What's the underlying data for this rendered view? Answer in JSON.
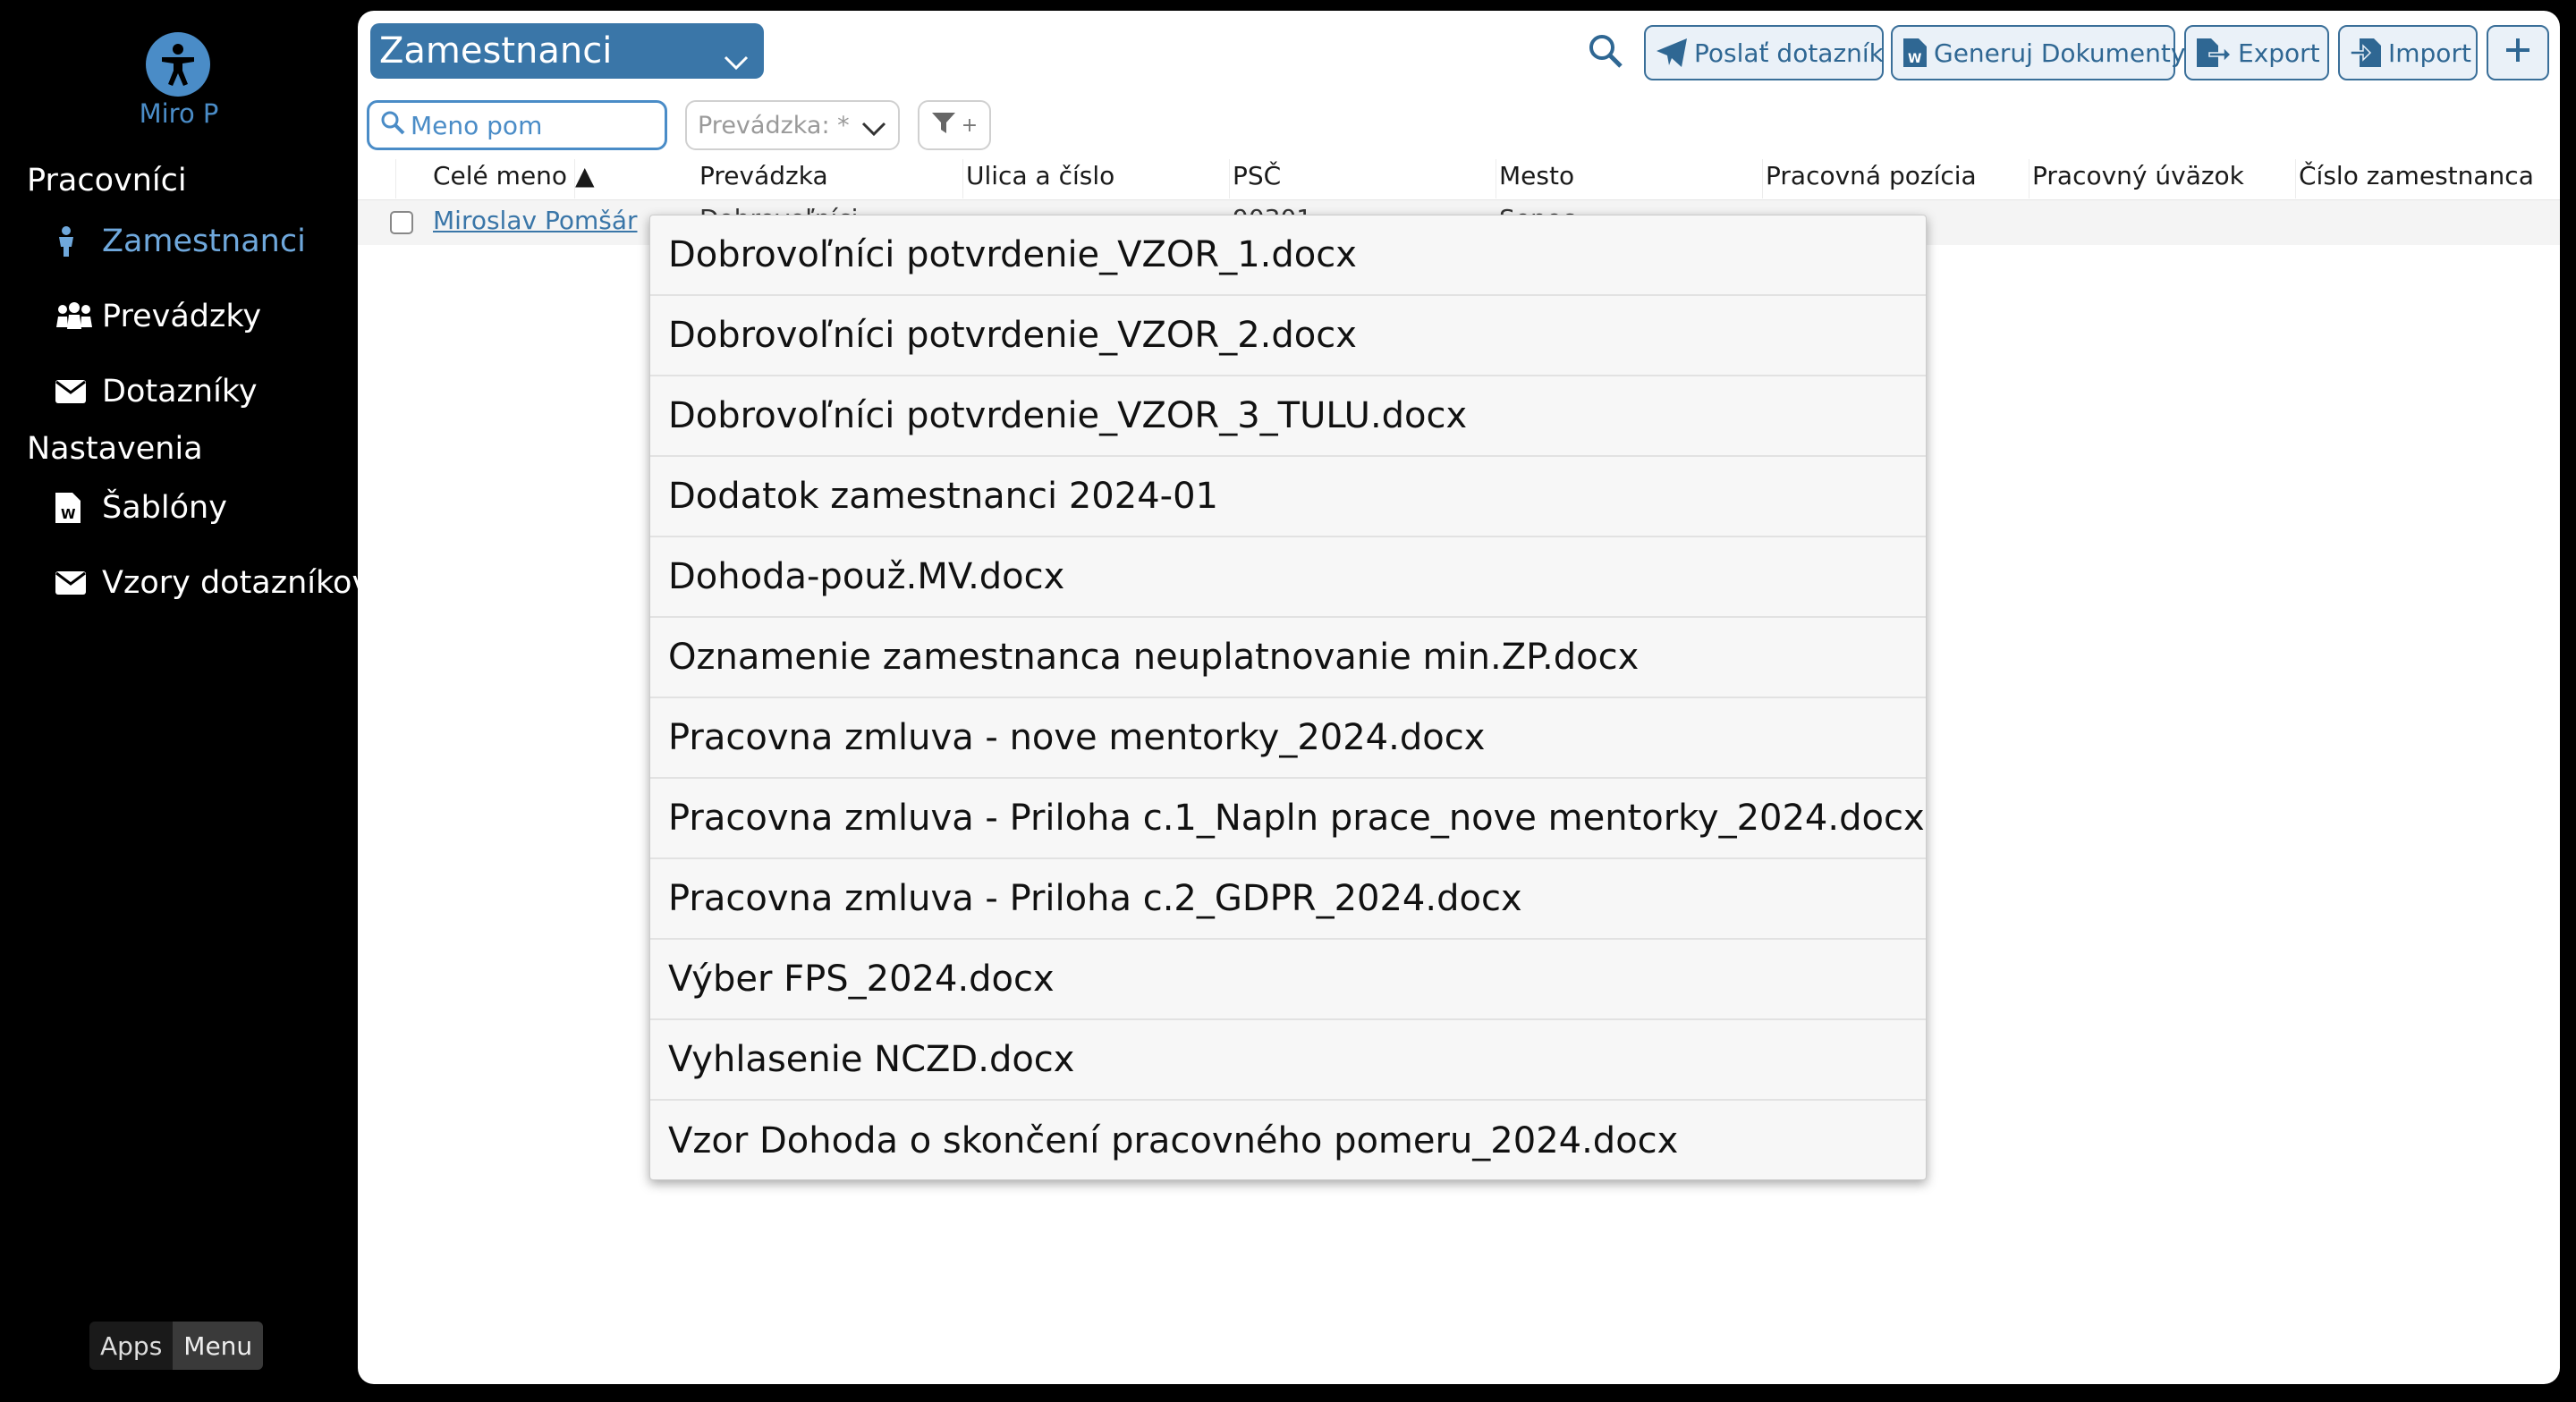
{
  "sidebar": {
    "user_name": "Miro P",
    "sections": [
      {
        "title": "Pracovníci",
        "items": [
          {
            "label": "Zamestnanci",
            "icon": "person-icon",
            "active": true
          },
          {
            "label": "Prevádzky",
            "icon": "people-group-icon",
            "active": false
          },
          {
            "label": "Dotazníky",
            "icon": "envelope-icon",
            "active": false
          }
        ]
      },
      {
        "title": "Nastavenia",
        "items": [
          {
            "label": "Šablóny",
            "icon": "word-file-icon",
            "active": false
          },
          {
            "label": "Vzory dotazníkov",
            "icon": "envelope-icon",
            "active": false
          }
        ]
      }
    ],
    "footer": {
      "apps_label": "Apps",
      "menu_label": "Menu"
    }
  },
  "toolbar": {
    "entity_select": "Zamestnanci",
    "send_questionnaire": "Poslať dotazník",
    "generate_documents": "Generuj Dokumenty",
    "export": "Export",
    "import": "Import"
  },
  "filters": {
    "search_value": "Meno pom",
    "store_placeholder": "Prevádzka: *",
    "filter_add": "+"
  },
  "table": {
    "columns": [
      "Celé meno ▲",
      "Prevádzka",
      "Ulica a číslo",
      "PSČ",
      "Mesto",
      "Pracovná pozícia",
      "Pracovný úväzok",
      "Číslo zamestnanca"
    ],
    "rows": [
      {
        "name": "Miroslav Pomšár",
        "store": "Dobrovoľníci",
        "street": "",
        "psc": "90301",
        "city": "Senec",
        "position": "",
        "workload": "",
        "employee_no": ""
      }
    ]
  },
  "documents_menu": [
    "Dobrovoľníci potvrdenie_VZOR_1.docx",
    "Dobrovoľníci potvrdenie_VZOR_2.docx",
    "Dobrovoľníci potvrdenie_VZOR_3_TULU.docx",
    "Dodatok zamestnanci 2024-01",
    "Dohoda-použ.MV.docx",
    "Oznamenie zamestnanca neuplatnovanie min.ZP.docx",
    "Pracovna zmluva - nove mentorky_2024.docx",
    "Pracovna zmluva - Priloha c.1_Napln prace_nove mentorky_2024.docx",
    "Pracovna zmluva - Priloha c.2_GDPR_2024.docx",
    "Výber FPS_2024.docx",
    "Vyhlasenie NCZD.docx",
    "Vzor Dohoda o skončení pracovného pomeru_2024.docx"
  ],
  "colors": {
    "accent": "#3a76a8",
    "sidebar_bg": "#000000",
    "active_nav": "#6fa8dc"
  }
}
